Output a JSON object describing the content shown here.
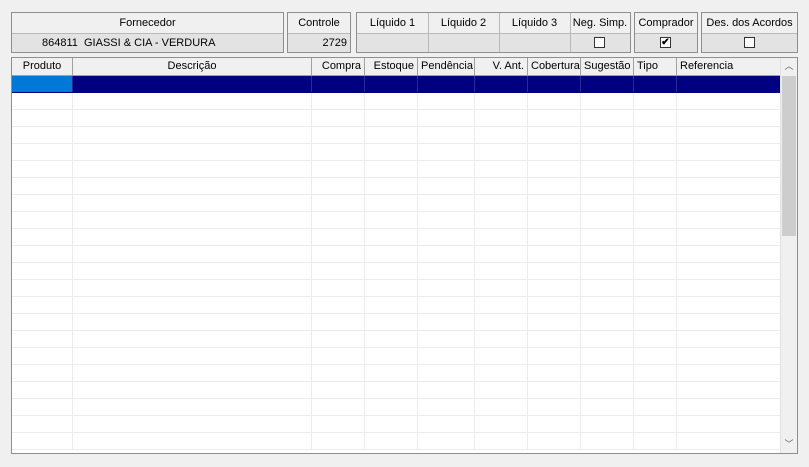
{
  "fornecedor": {
    "label": "Fornecedor",
    "code": "864811",
    "name": "GIASSI & CIA - VERDURA"
  },
  "controle": {
    "label": "Controle",
    "value": "2729"
  },
  "liquidos": {
    "l1": "Líquido 1",
    "l2": "Líquido 2",
    "l3": "Líquido 3",
    "neg_simp": "Neg. Simp.",
    "neg_simp_checked": false
  },
  "comprador": {
    "label": "Comprador",
    "checked": true,
    "check_glyph": "✔"
  },
  "des_acordos": {
    "label": "Des. dos Acordos",
    "checked": false
  },
  "grid": {
    "columns": [
      "Produto",
      "Descrição",
      "Compra",
      "Estoque",
      "Pendência",
      "V. Ant.",
      "Cobertura",
      "Sugestão",
      "Tipo",
      "Referencia"
    ],
    "selected_row": 0
  },
  "icons": {
    "scroll_up": "chevron-up-icon",
    "scroll_down": "chevron-down-icon"
  },
  "colors": {
    "selection": "#000080",
    "selection_first_cell": "#0078d7",
    "background": "#f0f0f0"
  }
}
